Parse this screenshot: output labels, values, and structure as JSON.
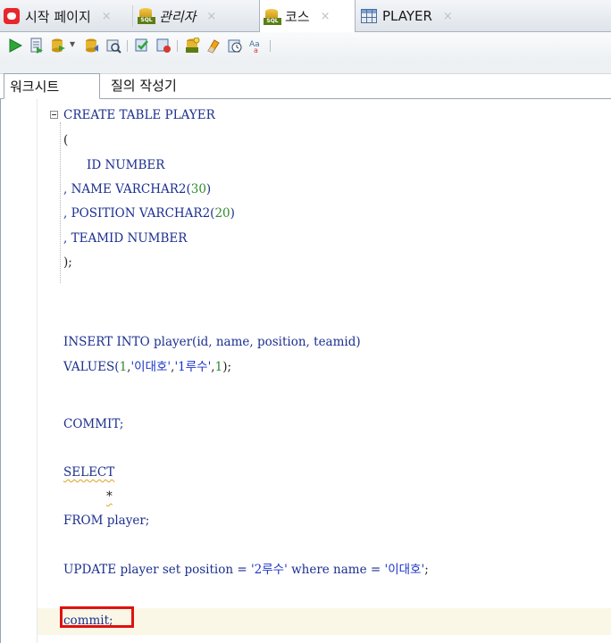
{
  "tabs": [
    {
      "label": "시작 페이지",
      "icon": "oracle-icon",
      "close": "×"
    },
    {
      "label": "관리자",
      "icon": "sql-db-icon",
      "close": "×",
      "italic": true
    },
    {
      "label": "코스",
      "icon": "sql-db-icon",
      "close": "×",
      "active": true
    },
    {
      "label": "PLAYER",
      "icon": "table-grid-icon",
      "close": "×"
    }
  ],
  "toolbar": {
    "icons": [
      "run-statement-icon",
      "run-script-icon",
      "commit-icon",
      "dropdown-arrow-icon",
      "rollback-icon",
      "explain-plan-icon",
      "autotrace-icon",
      "unshared-sql-icon",
      "sql-tuning-icon",
      "clear-icon",
      "history-icon",
      "format-icon"
    ],
    "dropdown_glyph": "▾"
  },
  "subtabs": {
    "worksheet": "워크시트",
    "query_builder": "질의 작성기"
  },
  "editor": {
    "lines": {
      "create": "CREATE TABLE PLAYER",
      "open_paren": "(",
      "col_id": "ID NUMBER",
      "col_name_prefix": ", NAME VARCHAR2(",
      "col_name_len": "30",
      "col_pos_prefix": ", POSITION VARCHAR2(",
      "col_pos_len": "20",
      "close_paren_suffix": ")",
      "col_team": ", TEAMID NUMBER",
      "close": ");",
      "insert": "INSERT INTO player(id, name, position, teamid)",
      "values_kw": "VALUES(",
      "values_1": "1",
      "values_str1": "'이대호'",
      "values_str2": "'1루수'",
      "values_end": ");",
      "comma": ",",
      "commit1": "COMMIT;",
      "select": "SELECT",
      "star": "*",
      "from": "FROM player;",
      "update_kw": "UPDATE player set position = ",
      "update_str1": "'2루수'",
      "update_mid": " where name = ",
      "update_str2": "'이대호'",
      "update_end": ";",
      "commit2": "commit;"
    }
  }
}
